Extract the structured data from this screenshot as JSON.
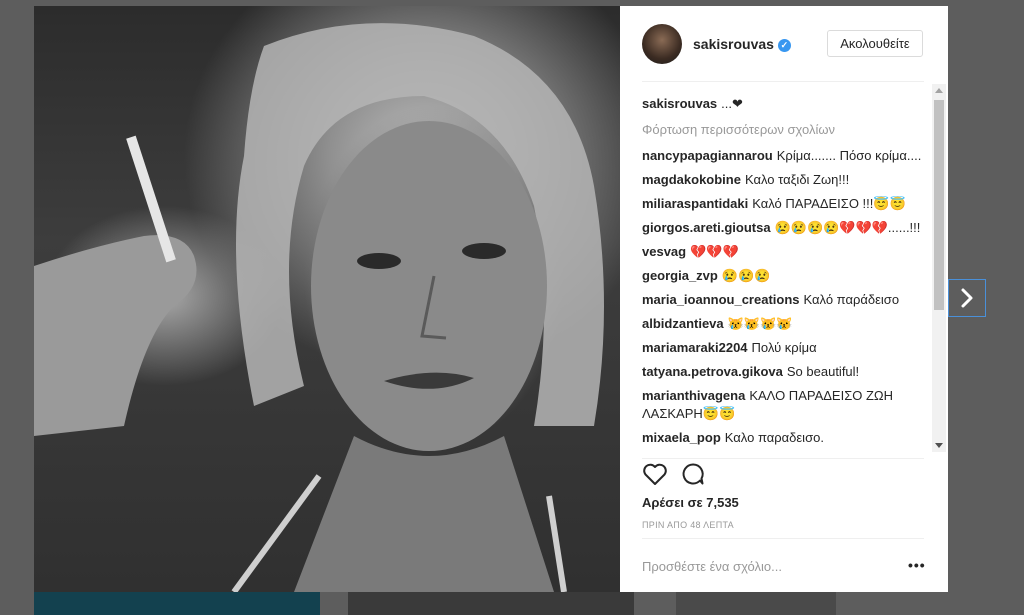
{
  "post": {
    "username": "sakisrouvas",
    "follow_label": "Ακολουθείτε",
    "caption": "...❤",
    "load_more_label": "Φόρτωση περισσότερων σχολίων",
    "comments": [
      {
        "user": "nancypapagiannarou",
        "text": "Κρίμα....... Πόσο κρίμα...."
      },
      {
        "user": "magdakokobine",
        "text": "Καλο ταξιδι Ζωη!!!"
      },
      {
        "user": "miliaraspantidaki",
        "text": "Καλό ΠΑΡΑΔΕΙΣΟ !!!😇😇"
      },
      {
        "user": "giorgos.areti.gioutsa",
        "text": "😢😢😢😢💔💔💔......!!!"
      },
      {
        "user": "vesvag",
        "text": "💔💔💔"
      },
      {
        "user": "georgia_zvp",
        "text": "😢😢😢"
      },
      {
        "user": "maria_ioannou_creations",
        "text": "Καλό παράδεισο"
      },
      {
        "user": "albidzantieva",
        "text": "😿😿😿😿"
      },
      {
        "user": "mariamaraki2204",
        "text": "Πολύ κρίμα"
      },
      {
        "user": "tatyana.petrova.gikova",
        "text": "So beautiful!"
      },
      {
        "user": "marianthivagena",
        "text": "ΚΑΛΟ ΠΑΡΑΔΕΙΣΟ ΖΩΗ ΛΑΣΚΑΡΗ😇😇"
      },
      {
        "user": "mixaela_pop",
        "text": "Καλο παραδεισο."
      }
    ],
    "likes_label": "Αρέσει σε 7,535",
    "timestamp": "ΠΡΙΝ ΑΠΟ 48 ΛΕΠΤΑ",
    "comment_placeholder": "Προσθέστε ένα σχόλιο...",
    "more_options": "•••"
  },
  "icons": {
    "like": "heart-icon",
    "comment": "comment-bubble-icon",
    "verified": "verified-badge-icon",
    "next": "chevron-right-icon",
    "more": "more-options-icon"
  },
  "colors": {
    "verified": "#3897f0",
    "text": "#262626",
    "muted": "#999999",
    "overlay": "#5d5d5d",
    "nav_focus": "#4a90d9"
  }
}
